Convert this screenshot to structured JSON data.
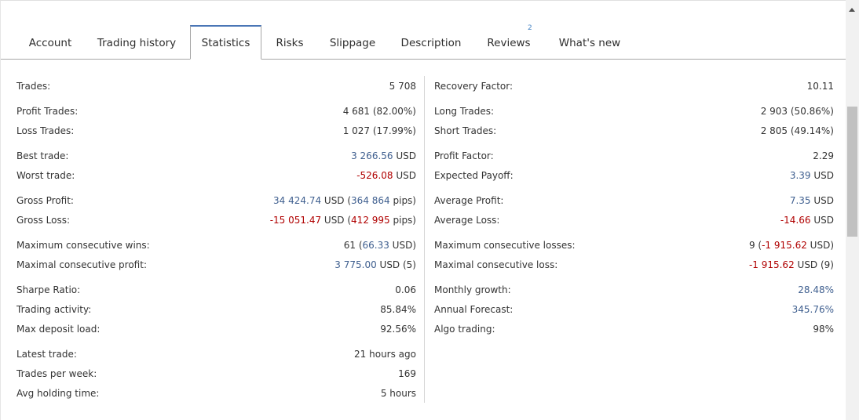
{
  "tabs": [
    {
      "label": "Account"
    },
    {
      "label": "Trading history"
    },
    {
      "label": "Statistics"
    },
    {
      "label": "Risks"
    },
    {
      "label": "Slippage"
    },
    {
      "label": "Description"
    },
    {
      "label": "Reviews",
      "badge": "2"
    },
    {
      "label": "What's new"
    }
  ],
  "colors": {
    "accent": "#4a76b6",
    "positive": "#3f5f8f",
    "negative": "#b00000"
  },
  "left": {
    "trades": {
      "label": "Trades:",
      "value": "5 708"
    },
    "profit_trades": {
      "label": "Profit Trades:",
      "value": "4 681 (82.00%)"
    },
    "loss_trades": {
      "label": "Loss Trades:",
      "value": "1 027 (17.99%)"
    },
    "best_trade": {
      "label": "Best trade:",
      "amount": "3 266.56",
      "unit": " USD"
    },
    "worst_trade": {
      "label": "Worst trade:",
      "amount": "-526.08",
      "unit": " USD"
    },
    "gross_profit": {
      "label": "Gross Profit:",
      "amount": "34 424.74",
      "mid": " USD (",
      "pips": "364 864",
      "end": " pips)"
    },
    "gross_loss": {
      "label": "Gross Loss:",
      "amount": "-15 051.47",
      "mid": " USD (",
      "pips": "412 995",
      "end": " pips)"
    },
    "max_consec_wins": {
      "label": "Maximum consecutive wins:",
      "count": "61 (",
      "amount": "66.33",
      "end": " USD)"
    },
    "max_consec_profit": {
      "label": "Maximal consecutive profit:",
      "amount": "3 775.00",
      "end": " USD (5)"
    },
    "sharpe": {
      "label": "Sharpe Ratio:",
      "value": "0.06"
    },
    "activity": {
      "label": "Trading activity:",
      "value": "85.84%"
    },
    "deposit_load": {
      "label": "Max deposit load:",
      "value": "92.56%"
    },
    "latest_trade": {
      "label": "Latest trade:",
      "value": "21 hours ago"
    },
    "trades_per_week": {
      "label": "Trades per week:",
      "value": "169"
    },
    "avg_holding": {
      "label": "Avg holding time:",
      "value": "5 hours"
    }
  },
  "right": {
    "recovery": {
      "label": "Recovery Factor:",
      "value": "10.11"
    },
    "long_trades": {
      "label": "Long Trades:",
      "value": "2 903 (50.86%)"
    },
    "short_trades": {
      "label": "Short Trades:",
      "value": "2 805 (49.14%)"
    },
    "profit_factor": {
      "label": "Profit Factor:",
      "value": "2.29"
    },
    "expected_payoff": {
      "label": "Expected Payoff:",
      "amount": "3.39",
      "unit": " USD"
    },
    "avg_profit": {
      "label": "Average Profit:",
      "amount": "7.35",
      "unit": " USD"
    },
    "avg_loss": {
      "label": "Average Loss:",
      "amount": "-14.66",
      "unit": " USD"
    },
    "max_consec_losses": {
      "label": "Maximum consecutive losses:",
      "count": "9 (",
      "amount": "-1 915.62",
      "end": " USD)"
    },
    "max_consec_loss": {
      "label": "Maximal consecutive loss:",
      "amount": "-1 915.62",
      "end": " USD (9)"
    },
    "monthly_growth": {
      "label": "Monthly growth:",
      "value": "28.48%"
    },
    "annual_forecast": {
      "label": "Annual Forecast:",
      "value": "345.76%"
    },
    "algo_trading": {
      "label": "Algo trading:",
      "value": "98%"
    }
  }
}
